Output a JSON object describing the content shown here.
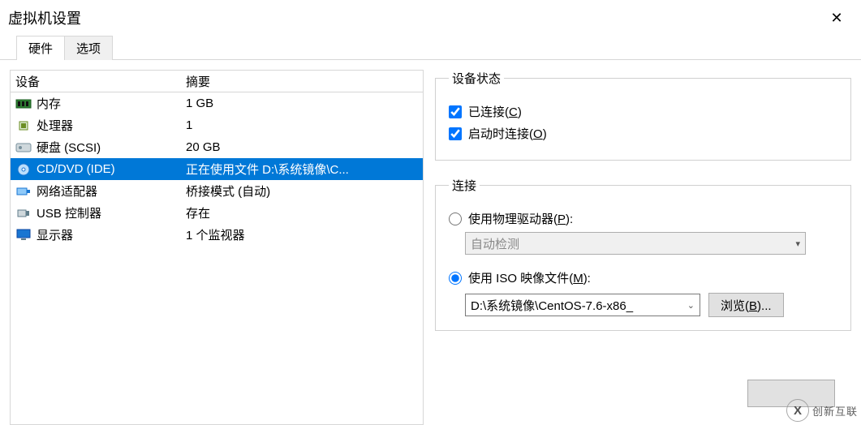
{
  "window": {
    "title": "虚拟机设置",
    "close_glyph": "✕"
  },
  "tabs": {
    "hardware": "硬件",
    "options": "选项"
  },
  "device_table": {
    "col_device": "设备",
    "col_summary": "摘要",
    "rows": [
      {
        "icon": "memory-icon",
        "name": "内存",
        "summary": "1 GB"
      },
      {
        "icon": "cpu-icon",
        "name": "处理器",
        "summary": "1"
      },
      {
        "icon": "disk-icon",
        "name": "硬盘 (SCSI)",
        "summary": "20 GB"
      },
      {
        "icon": "cd-icon",
        "name": "CD/DVD (IDE)",
        "summary": "正在使用文件 D:\\系统镜像\\C...",
        "selected": true
      },
      {
        "icon": "nic-icon",
        "name": "网络适配器",
        "summary": "桥接模式 (自动)"
      },
      {
        "icon": "usb-icon",
        "name": "USB 控制器",
        "summary": "存在"
      },
      {
        "icon": "display-icon",
        "name": "显示器",
        "summary": "1 个监视器"
      }
    ]
  },
  "status_group": {
    "legend": "设备状态",
    "connected_label": "已连接",
    "connected_hotkey": "C",
    "connect_at_power_label": "启动时连接",
    "connect_at_power_hotkey": "O"
  },
  "connection_group": {
    "legend": "连接",
    "physical_label": "使用物理驱动器",
    "physical_hotkey": "P",
    "physical_dropdown": "自动检测",
    "iso_label": "使用 ISO 映像文件",
    "iso_hotkey": "M",
    "iso_path": "D:\\系统镜像\\CentOS-7.6-x86_",
    "browse_label": "浏览",
    "browse_hotkey": "B",
    "browse_suffix": "..."
  },
  "watermark": {
    "logo_text": "X",
    "brand": "创新互联"
  }
}
